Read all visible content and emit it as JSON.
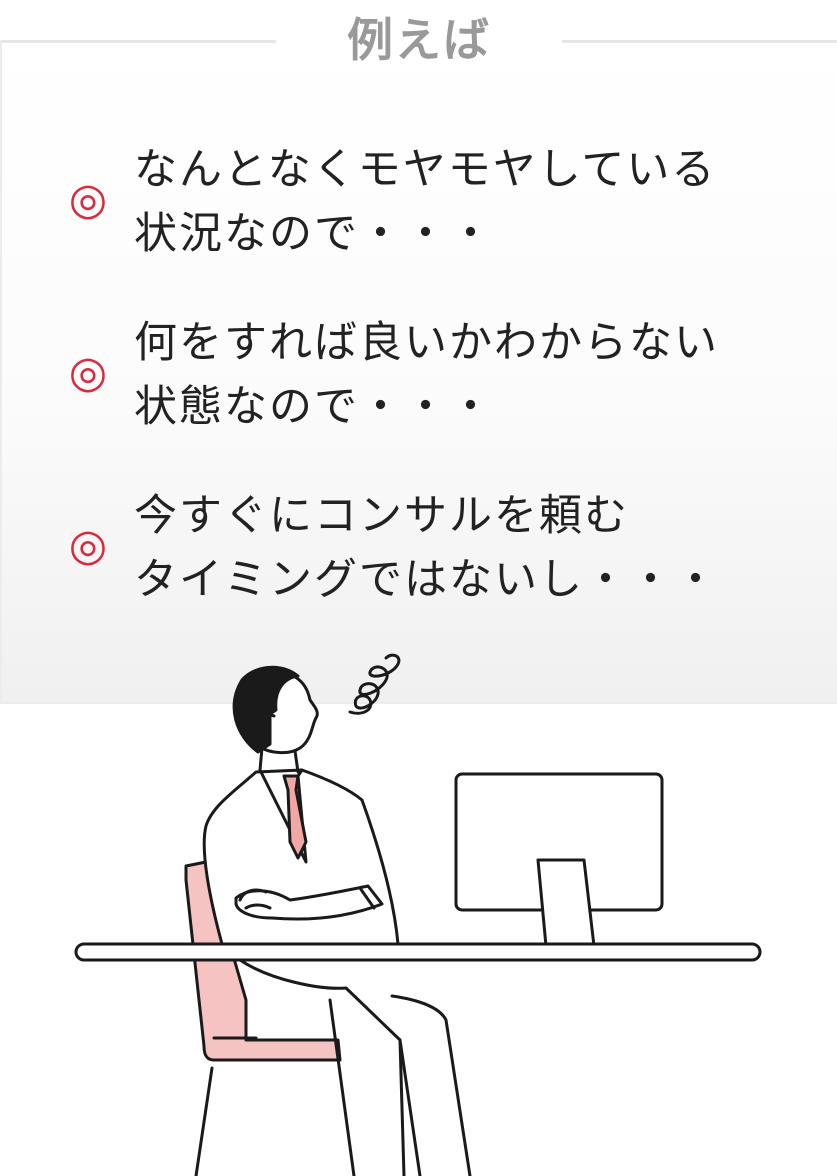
{
  "heading": "例えば",
  "bullet_symbol": "◎",
  "items": [
    {
      "line1": "なんとなくモヤモヤしている",
      "line2": "状況なので・・・"
    },
    {
      "line1": "何をすれば良いかわからない",
      "line2": "状態なので・・・"
    },
    {
      "line1": "今すぐにコンサルを頼む",
      "line2": "タイミングではないし・・・"
    }
  ],
  "colors": {
    "accent": "#d92a3e",
    "text": "#222222",
    "heading": "#999999",
    "tie": "#f2a7a7",
    "chair": "#f6c3c3"
  }
}
